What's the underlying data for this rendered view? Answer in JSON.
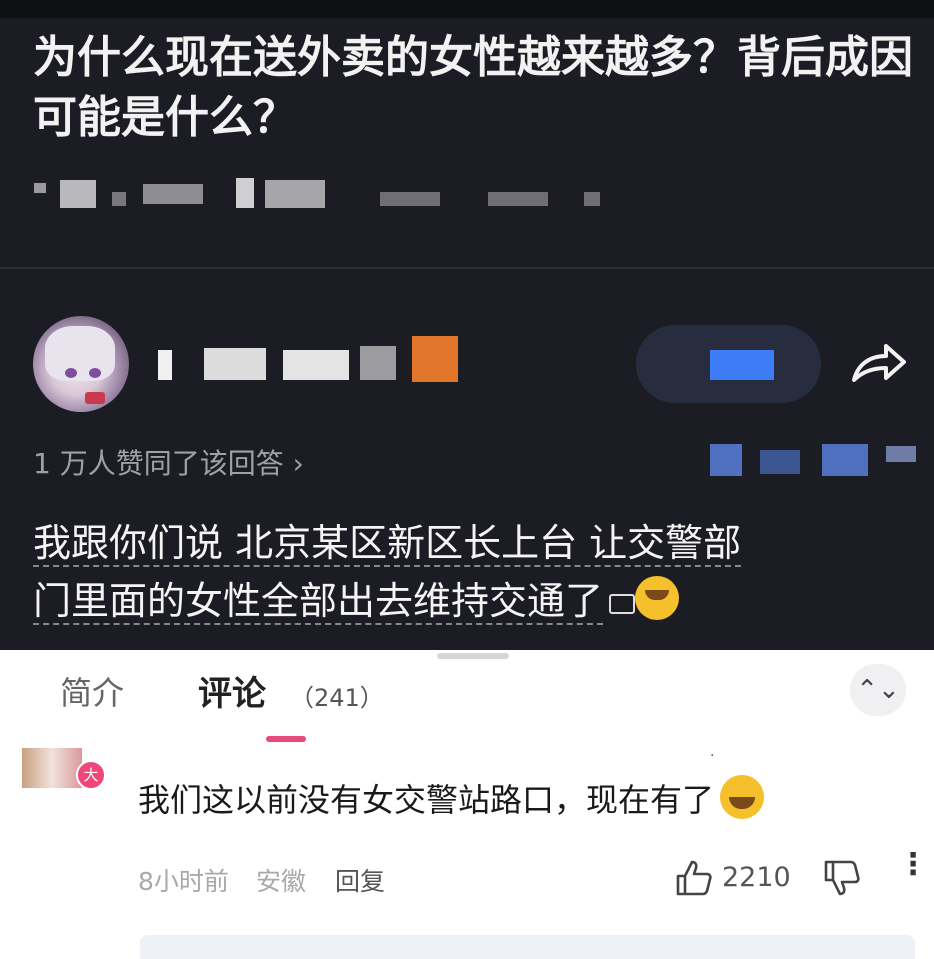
{
  "question": {
    "title": "为什么现在送外卖的女性越来越多？背后成因可能是什么？"
  },
  "answer": {
    "agree_text": "1 万人赞同了该回答 ›",
    "body_line1": "我跟你们说 北京某区新区长上台 让交警部",
    "body_line2": "门里面的女性全部出去维持交通了"
  },
  "icons": {
    "share": "share-arrow-icon",
    "like": "thumbs-up-icon",
    "dislike": "thumbs-down-icon",
    "sort": "sort-icon",
    "more": "more-vertical-icon"
  },
  "tabs": {
    "intro": "简介",
    "comments": "评论",
    "comments_count": "（241）",
    "sort_glyph": "⌃⌄"
  },
  "comment": {
    "badge": "大",
    "text": "我们这以前没有女交警站路口，现在有了",
    "time": "8小时前",
    "location": "安徽",
    "reply": "回复",
    "likes": "2210",
    "more_glyph": "⋮"
  },
  "colors": {
    "dark_bg": "#1c1d24",
    "accent_pink": "#e94a7c",
    "accent_blue": "#3d7cf5"
  }
}
